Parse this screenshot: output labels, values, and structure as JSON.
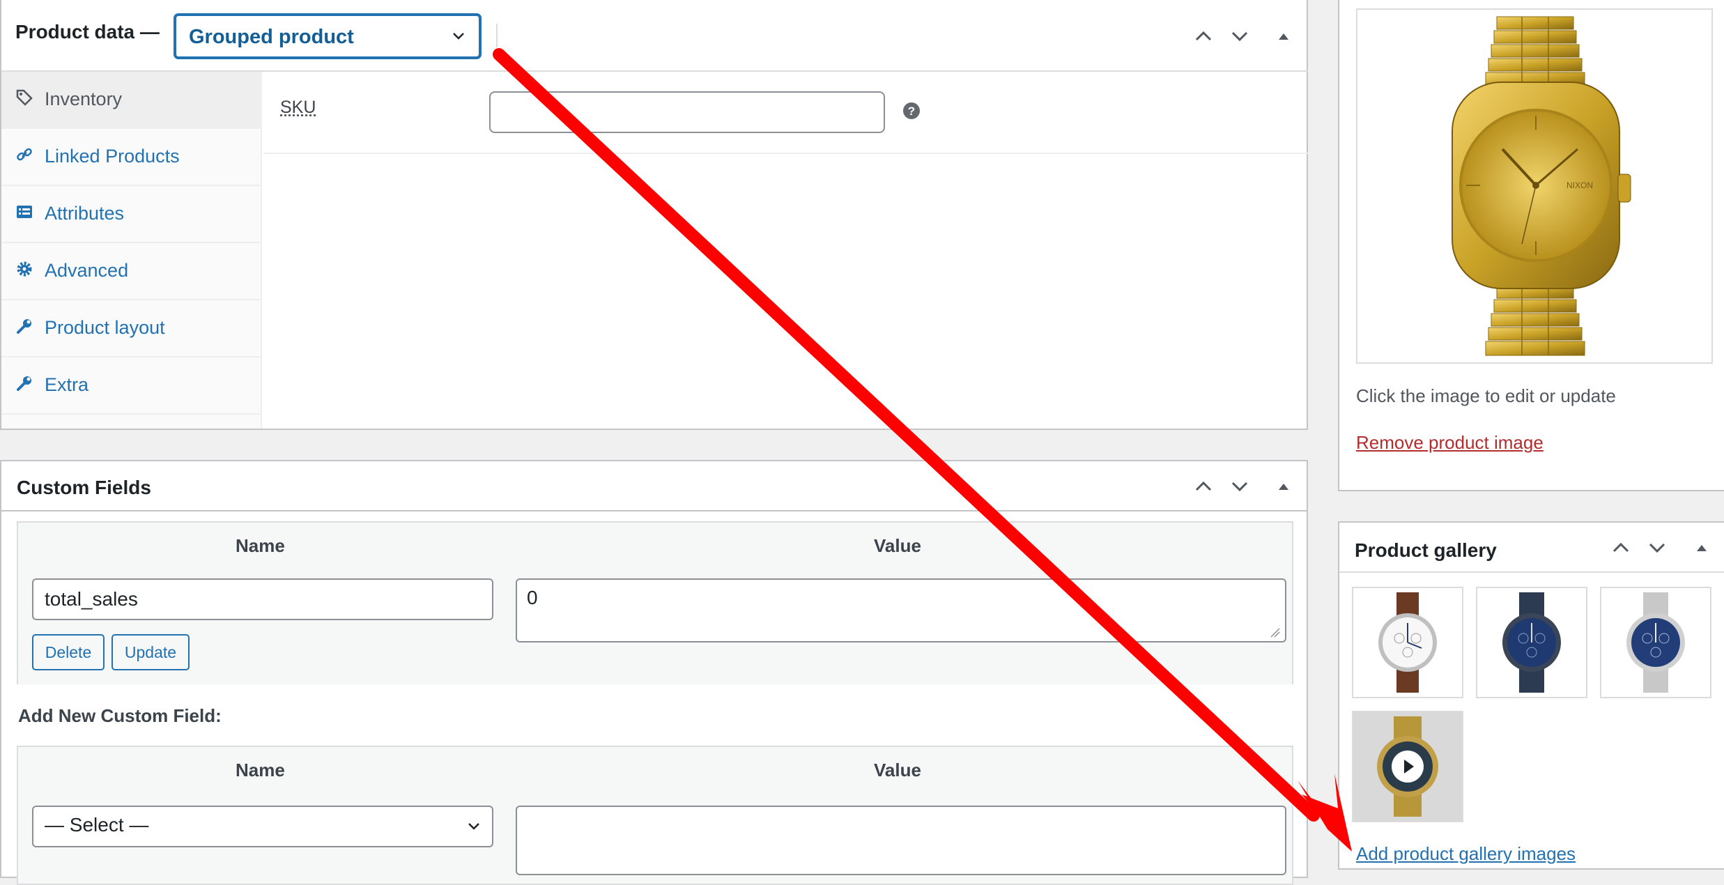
{
  "product_data": {
    "title": "Product data —",
    "type_select": {
      "value": "Grouped product"
    },
    "tabs": [
      {
        "label": "Inventory",
        "icon": "tag-icon",
        "active": true
      },
      {
        "label": "Linked Products",
        "icon": "link-icon"
      },
      {
        "label": "Attributes",
        "icon": "list-icon"
      },
      {
        "label": "Advanced",
        "icon": "gear-icon"
      },
      {
        "label": "Product layout",
        "icon": "wrench-icon"
      },
      {
        "label": "Extra",
        "icon": "wrench-icon"
      }
    ],
    "sku": {
      "label": "SKU",
      "value": "",
      "help_icon": "question-icon"
    }
  },
  "custom_fields": {
    "title": "Custom Fields",
    "columns": {
      "name": "Name",
      "value": "Value"
    },
    "row": {
      "name": "total_sales",
      "value": "0",
      "delete_label": "Delete",
      "update_label": "Update"
    },
    "add_new_label": "Add New Custom Field:",
    "new_field": {
      "select_value": "— Select —",
      "value": ""
    }
  },
  "product_image": {
    "hint": "Click the image to edit or update",
    "remove_label": "Remove product image"
  },
  "gallery": {
    "title": "Product gallery",
    "thumbnails": [
      {
        "name": "white-dial-brown-strap-watch"
      },
      {
        "name": "blue-dial-mesh-watch"
      },
      {
        "name": "blue-dial-steel-watch"
      },
      {
        "name": "gold-watch-video",
        "has_play_button": true
      }
    ],
    "add_label": "Add product gallery images"
  },
  "colors": {
    "accent": "#2271b1",
    "danger": "#b32d2e",
    "annotation_arrow": "#ff0000",
    "watch_gold": "#c9a227"
  }
}
